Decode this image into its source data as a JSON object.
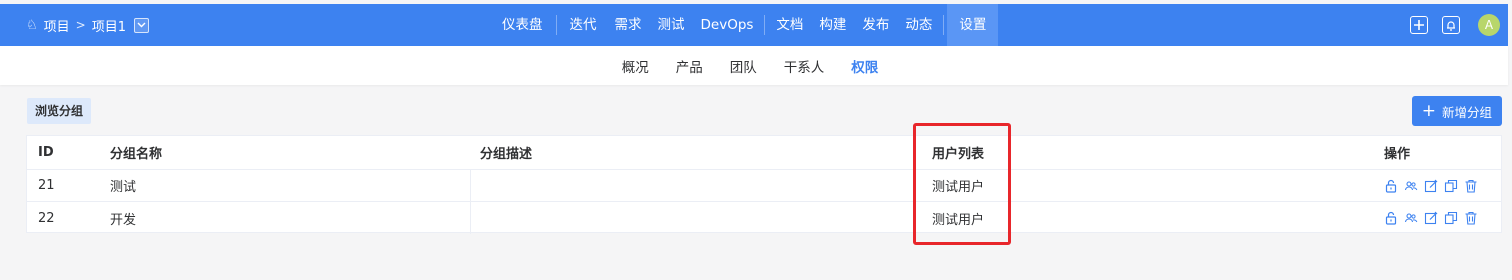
{
  "header": {
    "project_label": "项目",
    "breadcrumb_sep": ">",
    "project_name": "项目1",
    "nav": [
      "仪表盘",
      "迭代",
      "需求",
      "测试",
      "DevOps",
      "文档",
      "构建",
      "发布",
      "动态",
      "设置"
    ],
    "active_nav": "设置",
    "avatar_letter": "A"
  },
  "subnav": {
    "items": [
      "概况",
      "产品",
      "团队",
      "干系人",
      "权限"
    ],
    "active": "权限"
  },
  "content": {
    "group_tag": "浏览分组",
    "add_button": "新增分组"
  },
  "table": {
    "columns": {
      "id": "ID",
      "name": "分组名称",
      "desc": "分组描述",
      "users": "用户列表",
      "ops": "操作"
    },
    "rows": [
      {
        "id": "21",
        "name": "测试",
        "desc": "",
        "users": "测试用户"
      },
      {
        "id": "22",
        "name": "开发",
        "desc": "",
        "users": "测试用户"
      }
    ],
    "row_actions": [
      "lock-icon",
      "users-icon",
      "edit-icon",
      "copy-icon",
      "trash-icon"
    ]
  },
  "colors": {
    "primary": "#3d82f0",
    "highlight": "#e8262b",
    "active_nav_bg": "#5a96f5"
  }
}
